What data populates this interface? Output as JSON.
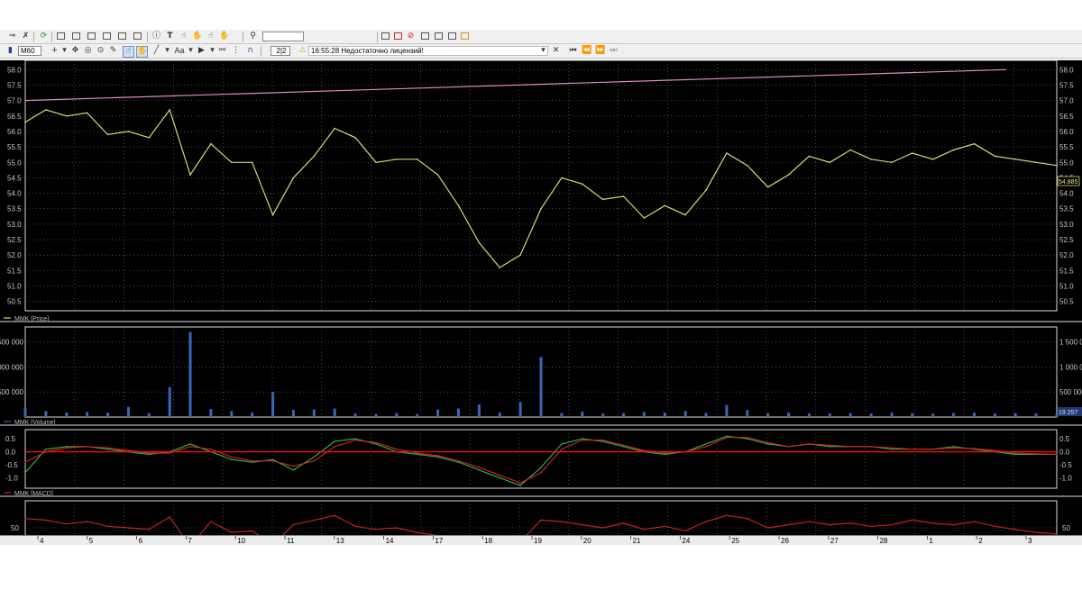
{
  "toolbar": {
    "interval": "M60",
    "page_indicator": "2|2",
    "status_time": "16:55:28",
    "status_message": "Недостаточно лицензий!",
    "font_label": "Aa"
  },
  "panes": {
    "price": {
      "legend": "MMK [Price]",
      "last_value": "54.885",
      "y_ticks": [
        "58.0",
        "57.5",
        "57.0",
        "56.5",
        "56.0",
        "55.5",
        "55.0",
        "54.5",
        "54.0",
        "53.5",
        "53.0",
        "52.5",
        "52.0",
        "51.5",
        "51.0",
        "50.5"
      ]
    },
    "volume": {
      "legend": "MMK [Volume]",
      "last_value": "19 257",
      "y_ticks_left": [
        "1 500 000",
        "1 000 000",
        "500 000"
      ],
      "y_ticks_right": [
        "1 500 000",
        "1 000 000",
        "500 000"
      ]
    },
    "macd": {
      "legend": "MMK [MACD]",
      "y_ticks": [
        "0.5",
        "0.0",
        "-0.5",
        "-1.0"
      ]
    },
    "rsi": {
      "legend": "MMK [RSI]",
      "y_ticks": [
        "50"
      ]
    }
  },
  "x_axis": {
    "labels": [
      "4",
      "5",
      "6",
      "7",
      "10",
      "11",
      "13",
      "14",
      "17",
      "18",
      "19",
      "20",
      "21",
      "24",
      "25",
      "26",
      "27",
      "28",
      "1",
      "2",
      "3"
    ]
  },
  "colors": {
    "price": "#d8d878",
    "trend": "#e888c8",
    "volume": "#3a66b8",
    "macd": "#2fae3a",
    "signal": "#cc2222",
    "zero": "#ee1111",
    "rsi": "#c42020"
  },
  "chart_data": [
    {
      "type": "line",
      "title": "MMK [Price]",
      "ylim": [
        50.2,
        58.3
      ],
      "x": [
        0,
        2,
        4,
        6,
        8,
        10,
        12,
        14,
        16,
        18,
        20,
        22,
        24,
        26,
        28,
        30,
        32,
        34,
        36,
        38,
        40,
        42,
        44,
        46,
        48,
        50,
        52,
        54,
        56,
        58,
        60,
        62,
        64,
        66,
        68,
        70,
        72,
        74,
        76,
        78,
        80,
        82,
        84,
        86,
        88,
        90,
        92,
        94,
        96,
        98,
        100
      ],
      "series": [
        {
          "name": "MMK [Price]",
          "values": [
            56.3,
            56.7,
            56.5,
            56.6,
            55.9,
            56.0,
            55.8,
            56.7,
            54.6,
            55.6,
            55.0,
            55.0,
            53.3,
            54.5,
            55.2,
            56.1,
            55.8,
            55.0,
            55.1,
            55.1,
            54.6,
            53.6,
            52.4,
            51.6,
            52.0,
            53.5,
            54.5,
            54.3,
            53.8,
            53.9,
            53.2,
            53.6,
            53.3,
            54.1,
            55.3,
            54.9,
            54.2,
            54.6,
            55.2,
            55.0,
            55.4,
            55.1,
            55.0,
            55.3,
            55.1,
            55.4,
            55.6,
            55.2,
            55.1,
            55.0,
            54.9
          ]
        },
        {
          "name": "trend",
          "values_x": [
            0,
            95
          ],
          "values": [
            57.0,
            58.0
          ]
        }
      ]
    },
    {
      "type": "bar",
      "title": "MMK [Volume]",
      "ylim": [
        0,
        1800000
      ],
      "x": [
        0,
        2,
        4,
        6,
        8,
        10,
        12,
        14,
        16,
        18,
        20,
        22,
        24,
        26,
        28,
        30,
        32,
        34,
        36,
        38,
        40,
        42,
        44,
        46,
        48,
        50,
        52,
        54,
        56,
        58,
        60,
        62,
        64,
        66,
        68,
        70,
        72,
        74,
        76,
        78,
        80,
        82,
        84,
        86,
        88,
        90,
        92,
        94,
        96,
        98,
        100
      ],
      "values": [
        180000,
        120000,
        90000,
        100000,
        90000,
        200000,
        80000,
        600000,
        1700000,
        160000,
        120000,
        90000,
        500000,
        140000,
        150000,
        170000,
        70000,
        60000,
        80000,
        60000,
        150000,
        170000,
        250000,
        90000,
        300000,
        1200000,
        80000,
        110000,
        70000,
        80000,
        100000,
        90000,
        120000,
        80000,
        240000,
        140000,
        80000,
        90000,
        70000,
        70000,
        80000,
        70000,
        90000,
        80000,
        70000,
        80000,
        90000,
        70000,
        80000,
        70000,
        60000
      ]
    },
    {
      "type": "line",
      "title": "MMK [MACD]",
      "ylim": [
        -1.4,
        0.85
      ],
      "x": [
        0,
        2,
        4,
        6,
        8,
        10,
        12,
        14,
        16,
        18,
        20,
        22,
        24,
        26,
        28,
        30,
        32,
        34,
        36,
        38,
        40,
        42,
        44,
        46,
        48,
        50,
        52,
        54,
        56,
        58,
        60,
        62,
        64,
        66,
        68,
        70,
        72,
        74,
        76,
        78,
        80,
        82,
        84,
        86,
        88,
        90,
        92,
        94,
        96,
        98,
        100
      ],
      "series": [
        {
          "name": "MACD",
          "values": [
            -0.8,
            0.1,
            0.2,
            0.2,
            0.1,
            0.0,
            -0.1,
            0.0,
            0.3,
            0.0,
            -0.3,
            -0.4,
            -0.3,
            -0.7,
            -0.2,
            0.4,
            0.5,
            0.3,
            0.0,
            -0.1,
            -0.2,
            -0.4,
            -0.7,
            -1.0,
            -1.3,
            -0.6,
            0.3,
            0.5,
            0.4,
            0.2,
            0.0,
            -0.1,
            0.0,
            0.3,
            0.6,
            0.5,
            0.3,
            0.2,
            0.3,
            0.2,
            0.2,
            0.2,
            0.1,
            0.1,
            0.1,
            0.2,
            0.1,
            0.0,
            -0.1,
            -0.1,
            -0.1
          ]
        },
        {
          "name": "Signal",
          "values": [
            -0.4,
            0.0,
            0.15,
            0.2,
            0.15,
            0.05,
            -0.05,
            -0.05,
            0.2,
            0.1,
            -0.2,
            -0.35,
            -0.35,
            -0.55,
            -0.35,
            0.2,
            0.45,
            0.35,
            0.1,
            -0.05,
            -0.15,
            -0.35,
            -0.6,
            -0.9,
            -1.2,
            -0.8,
            0.1,
            0.45,
            0.45,
            0.25,
            0.05,
            -0.05,
            0.0,
            0.2,
            0.55,
            0.55,
            0.35,
            0.2,
            0.3,
            0.25,
            0.2,
            0.2,
            0.15,
            0.1,
            0.1,
            0.15,
            0.12,
            0.05,
            -0.05,
            -0.08,
            -0.1
          ]
        }
      ]
    },
    {
      "type": "line",
      "title": "MMK [RSI]",
      "ylim": [
        15,
        85
      ],
      "x": [
        0,
        2,
        4,
        6,
        8,
        10,
        12,
        14,
        16,
        18,
        20,
        22,
        24,
        26,
        28,
        30,
        32,
        34,
        36,
        38,
        40,
        42,
        44,
        46,
        48,
        50,
        52,
        54,
        56,
        58,
        60,
        62,
        64,
        66,
        68,
        70,
        72,
        74,
        76,
        78,
        80,
        82,
        84,
        86,
        88,
        90,
        92,
        94,
        96,
        98,
        100
      ],
      "series": [
        {
          "name": "MMK [RSI]",
          "values": [
            62,
            60,
            55,
            58,
            52,
            50,
            48,
            64,
            26,
            58,
            44,
            46,
            28,
            54,
            60,
            66,
            52,
            48,
            50,
            44,
            40,
            30,
            25,
            28,
            32,
            60,
            58,
            54,
            50,
            56,
            48,
            52,
            46,
            58,
            66,
            62,
            50,
            54,
            58,
            54,
            56,
            52,
            54,
            60,
            56,
            54,
            58,
            52,
            48,
            44,
            42
          ]
        }
      ]
    }
  ]
}
